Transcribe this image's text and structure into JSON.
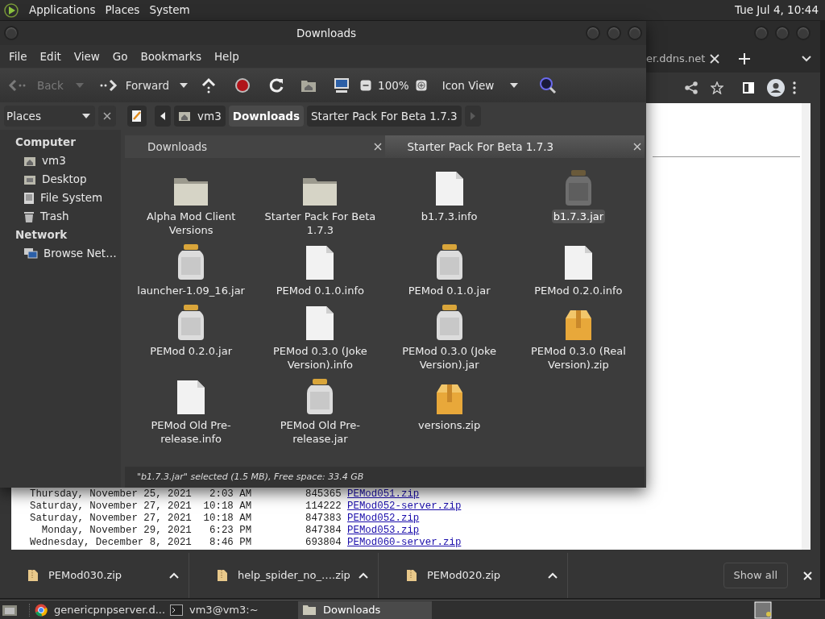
{
  "top_panel": {
    "menus": [
      "Applications",
      "Places",
      "System"
    ],
    "clock": "Tue Jul 4, 10:44"
  },
  "browser": {
    "tab_title": "er.ddns.net",
    "listing": [
      {
        "date": "Thursday, November 25, 2021",
        "time": "2:03 AM",
        "size": "845365",
        "file": "PEMod051.zip"
      },
      {
        "date": "Saturday, November 27, 2021",
        "time": "10:18 AM",
        "size": "114222",
        "file": "PEMod052-server.zip"
      },
      {
        "date": "Saturday, November 27, 2021",
        "time": "10:18 AM",
        "size": "847383",
        "file": "PEMod052.zip"
      },
      {
        "date": "Monday, November 29, 2021",
        "time": "6:23 PM",
        "size": "847384",
        "file": "PEMod053.zip"
      },
      {
        "date": "Wednesday, December 8, 2021",
        "time": "8:46 PM",
        "size": "693804",
        "file": "PEMod060-server.zip"
      }
    ],
    "downloads": [
      {
        "name": "PEMod030.zip"
      },
      {
        "name": "help_spider_no_….zip"
      },
      {
        "name": "PEMod020.zip"
      }
    ],
    "show_all": "Show all"
  },
  "file_manager": {
    "title": "Downloads",
    "menu": [
      "File",
      "Edit",
      "View",
      "Go",
      "Bookmarks",
      "Help"
    ],
    "toolbar": {
      "back": "Back",
      "back_disabled": true,
      "forward": "Forward",
      "forward_disabled": false,
      "zoom": "100%",
      "view": "Icon View"
    },
    "places_combo": "Places",
    "path": [
      {
        "label": "vm3",
        "kind": "home",
        "selected": false
      },
      {
        "label": "Downloads",
        "kind": "folder",
        "selected": true
      },
      {
        "label": "Starter Pack For Beta 1.7.3",
        "kind": "folder",
        "selected": false
      }
    ],
    "sidebar": [
      {
        "heading": "Computer",
        "items": [
          {
            "label": "vm3",
            "kind": "home"
          },
          {
            "label": "Desktop",
            "kind": "desktop"
          },
          {
            "label": "File System",
            "kind": "drive"
          },
          {
            "label": "Trash",
            "kind": "trash"
          }
        ]
      },
      {
        "heading": "Network",
        "items": [
          {
            "label": "Browse Net…",
            "kind": "network"
          }
        ]
      }
    ],
    "tabs": [
      {
        "label": "Downloads",
        "selected": true
      },
      {
        "label": "Starter Pack For Beta 1.7.3",
        "selected": false
      }
    ],
    "items": [
      {
        "name": "Alpha Mod Client Versions",
        "kind": "folder",
        "selected": false
      },
      {
        "name": "Starter Pack For Beta 1.7.3",
        "kind": "folder",
        "selected": false
      },
      {
        "name": "b1.7.3.info",
        "kind": "file",
        "selected": false
      },
      {
        "name": "b1.7.3.jar",
        "kind": "jar",
        "selected": true
      },
      {
        "name": "launcher-1.09_16.jar",
        "kind": "jar",
        "selected": false
      },
      {
        "name": "PEMod 0.1.0.info",
        "kind": "file",
        "selected": false
      },
      {
        "name": "PEMod 0.1.0.jar",
        "kind": "jar",
        "selected": false
      },
      {
        "name": "PEMod 0.2.0.info",
        "kind": "file",
        "selected": false
      },
      {
        "name": "PEMod 0.2.0.jar",
        "kind": "jar",
        "selected": false
      },
      {
        "name": "PEMod 0.3.0 (Joke Version).info",
        "kind": "file",
        "selected": false
      },
      {
        "name": "PEMod 0.3.0 (Joke Version).jar",
        "kind": "jar",
        "selected": false
      },
      {
        "name": "PEMod 0.3.0 (Real Version).zip",
        "kind": "zip",
        "selected": false
      },
      {
        "name": "PEMod Old Pre-release.info",
        "kind": "file",
        "selected": false
      },
      {
        "name": "PEMod Old Pre-release.jar",
        "kind": "jar",
        "selected": false
      },
      {
        "name": "versions.zip",
        "kind": "zip",
        "selected": false
      }
    ],
    "status": "\"b1.7.3.jar\" selected (1.5 MB), Free space: 33.4 GB"
  },
  "taskbar": [
    {
      "label": "genericpnpserver.d...",
      "kind": "browser",
      "selected": false
    },
    {
      "label": "vm3@vm3:~",
      "kind": "terminal",
      "selected": false
    },
    {
      "label": "Downloads",
      "kind": "folder",
      "selected": true
    }
  ]
}
